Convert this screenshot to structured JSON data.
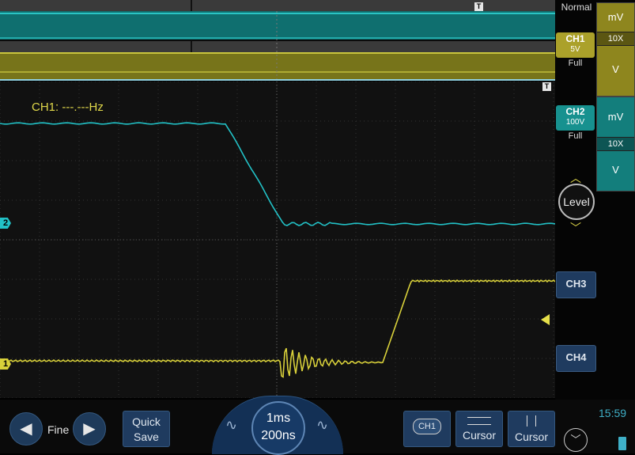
{
  "trigger_mode": "Normal",
  "measurement": {
    "label": "CH1: ---.---Hz"
  },
  "markers": {
    "ch2": "2",
    "ch1": "1",
    "trigger_t": "T"
  },
  "channels": {
    "ch1": {
      "label": "CH1",
      "scale": "5V",
      "bandwidth": "Full",
      "units": [
        "mV",
        "10X",
        "V"
      ],
      "color": "#c9c02a"
    },
    "ch2": {
      "label": "CH2",
      "scale": "100V",
      "bandwidth": "Full",
      "units": [
        "mV",
        "10X",
        "V"
      ],
      "color": "#1aa9a6"
    },
    "ch3": {
      "label": "CH3"
    },
    "ch4": {
      "label": "CH4"
    }
  },
  "trigger": {
    "level_label": "Level",
    "chevron_up": "︿",
    "chevron_down": "﹀"
  },
  "bottom": {
    "fine_label": "Fine",
    "quick_save": [
      "Quick",
      "Save"
    ],
    "timebase": "1ms",
    "sample": "200ns",
    "ch1_chip": "CH1",
    "cursor_h": "Cursor",
    "cursor_v": "Cursor",
    "time": "15:59"
  },
  "colors": {
    "ch1": "#d8d03a",
    "ch2": "#22c1c6",
    "accent": "#1f3b5f"
  }
}
